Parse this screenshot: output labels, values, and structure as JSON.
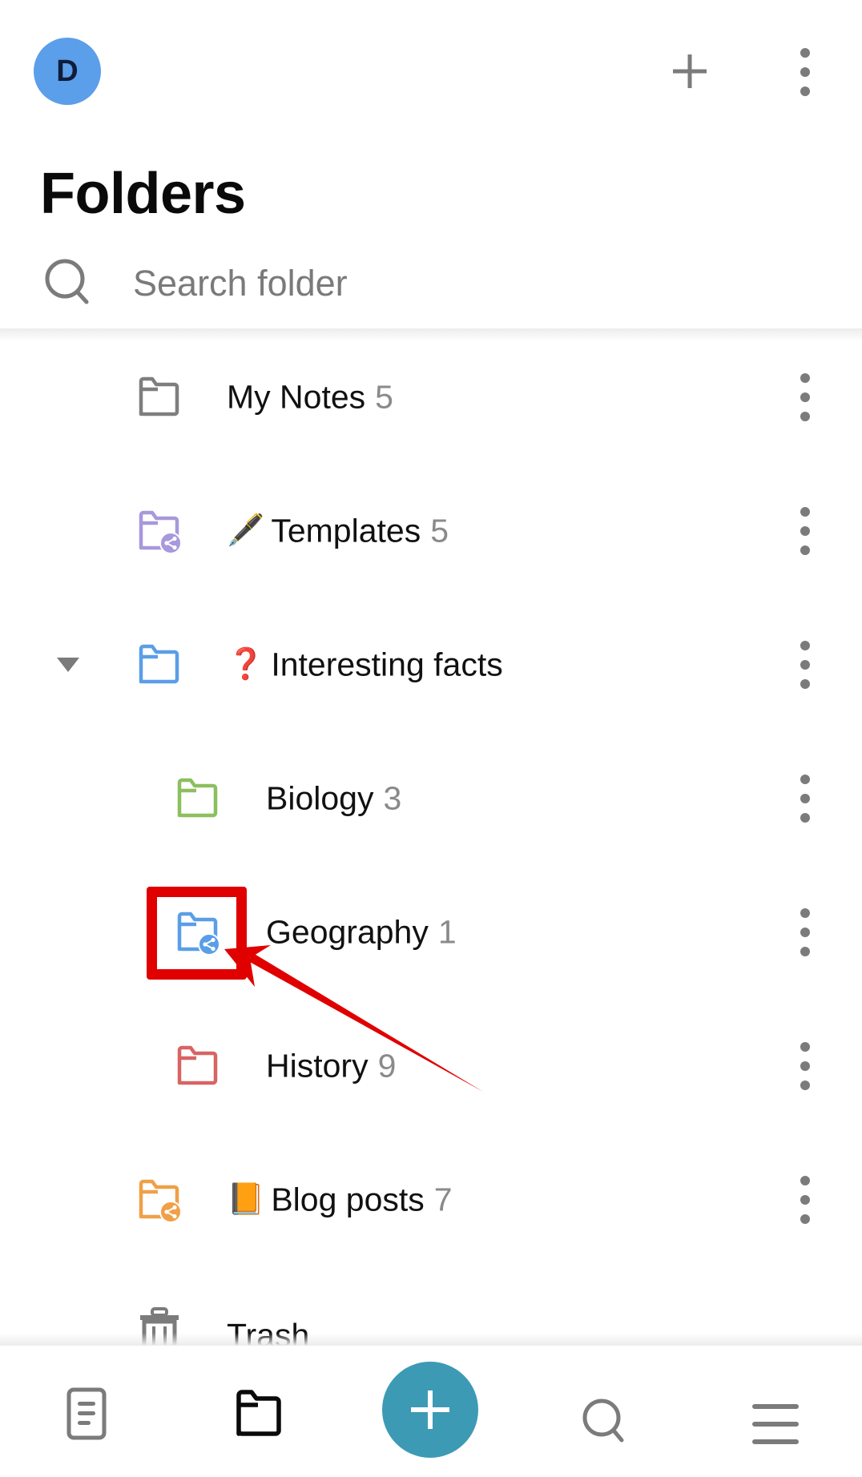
{
  "header": {
    "avatar_initial": "D",
    "avatar_color": "#5b9eea",
    "add_icon": "plus-icon",
    "more_icon": "more-vertical-icon"
  },
  "page": {
    "title": "Folders"
  },
  "search": {
    "icon": "search-icon",
    "placeholder": "Search folder",
    "value": ""
  },
  "folders": [
    {
      "name": "My Notes",
      "emoji": "",
      "count": "5",
      "icon": "folder-icon",
      "shared": false,
      "color": "#7e7e7e",
      "level": 0,
      "expanded": null
    },
    {
      "name": "Templates",
      "emoji": "🖋️",
      "count": "5",
      "icon": "shared-folder-icon",
      "shared": true,
      "color": "#a898dc",
      "level": 0,
      "expanded": null
    },
    {
      "name": "Interesting facts",
      "emoji": "❓",
      "count": "",
      "icon": "folder-icon",
      "shared": false,
      "color": "#5a9ee8",
      "level": 0,
      "expanded": true
    },
    {
      "name": "Biology",
      "emoji": "",
      "count": "3",
      "icon": "folder-icon",
      "shared": false,
      "color": "#8cbf5e",
      "level": 1,
      "expanded": null
    },
    {
      "name": "Geography",
      "emoji": "",
      "count": "1",
      "icon": "shared-folder-icon",
      "shared": true,
      "color": "#5a9ee8",
      "level": 1,
      "expanded": null
    },
    {
      "name": "History",
      "emoji": "",
      "count": "9",
      "icon": "folder-icon",
      "shared": false,
      "color": "#d86464",
      "level": 1,
      "expanded": null
    },
    {
      "name": "Blog posts",
      "emoji": "📙",
      "count": "7",
      "icon": "shared-folder-icon",
      "shared": true,
      "color": "#f0a048",
      "level": 0,
      "expanded": null
    }
  ],
  "trash": {
    "label": "Trash",
    "icon": "trash-icon"
  },
  "bottom_nav": {
    "items": [
      {
        "name": "notes",
        "icon": "note-icon",
        "active": false
      },
      {
        "name": "folders",
        "icon": "folder-icon",
        "active": true
      },
      {
        "name": "new-note",
        "icon": "plus-icon",
        "active": false
      },
      {
        "name": "search",
        "icon": "search-icon",
        "active": false
      },
      {
        "name": "menu",
        "icon": "hamburger-menu-icon",
        "active": false
      }
    ],
    "fab_color": "#3d9ab5",
    "inactive_color": "#7b7b7b",
    "active_color": "#0a0a0a"
  },
  "annotation": {
    "highlight_color": "#e00000",
    "target": "Geography shared-folder icon"
  }
}
